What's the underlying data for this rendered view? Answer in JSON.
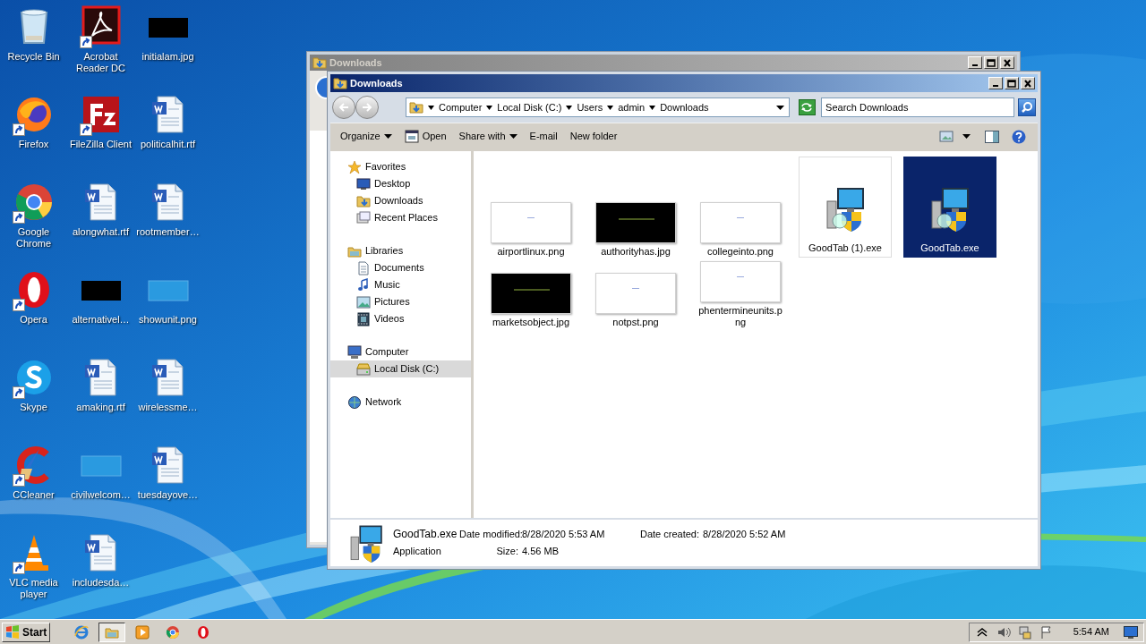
{
  "desktop_icons": [
    {
      "label": "Recycle Bin",
      "kind": "recycle",
      "shortcut": false
    },
    {
      "label": "Acrobat Reader DC",
      "kind": "acrobat",
      "shortcut": true
    },
    {
      "label": "initialam.jpg",
      "kind": "dark",
      "shortcut": false
    },
    {
      "label": "Firefox",
      "kind": "firefox",
      "shortcut": true
    },
    {
      "label": "FileZilla Client",
      "kind": "filezilla",
      "shortcut": true
    },
    {
      "label": "politicalhit.rtf",
      "kind": "document",
      "shortcut": false
    },
    {
      "label": "Google Chrome",
      "kind": "chrome",
      "shortcut": true
    },
    {
      "label": "alongwhat.rtf",
      "kind": "document",
      "shortcut": false
    },
    {
      "label": "rootmember…",
      "kind": "document",
      "shortcut": false
    },
    {
      "label": "Opera",
      "kind": "opera",
      "shortcut": true
    },
    {
      "label": "alternativel…",
      "kind": "dark",
      "shortcut": false
    },
    {
      "label": "showunit.png",
      "kind": "blank",
      "shortcut": false
    },
    {
      "label": "Skype",
      "kind": "skype",
      "shortcut": true
    },
    {
      "label": "amaking.rtf",
      "kind": "document",
      "shortcut": false
    },
    {
      "label": "wirelessme…",
      "kind": "document",
      "shortcut": false
    },
    {
      "label": "CCleaner",
      "kind": "ccleaner",
      "shortcut": true
    },
    {
      "label": "civilwelcom…",
      "kind": "blank",
      "shortcut": false
    },
    {
      "label": "tuesdayove…",
      "kind": "document",
      "shortcut": false
    },
    {
      "label": "VLC media player",
      "kind": "vlc",
      "shortcut": true
    },
    {
      "label": "includesda…",
      "kind": "document",
      "shortcut": false
    }
  ],
  "back_window": {
    "title": "Downloads"
  },
  "window": {
    "title": "Downloads",
    "breadcrumbs": [
      "Computer",
      "Local Disk (C:)",
      "Users",
      "admin",
      "Downloads"
    ],
    "search": {
      "placeholder": "Search Downloads"
    },
    "toolbar": [
      {
        "label": "Organize",
        "kind": "text",
        "menu": true
      },
      {
        "label": "Open",
        "kind": "open",
        "menu": false
      },
      {
        "label": "Share with",
        "kind": "text",
        "menu": true
      },
      {
        "label": "E-mail",
        "kind": "text",
        "menu": false
      },
      {
        "label": "New folder",
        "kind": "text",
        "menu": false
      }
    ],
    "navigation": [
      {
        "label": "Favorites",
        "kind": "star",
        "selected": false,
        "children": [
          {
            "label": "Desktop",
            "kind": "desktop",
            "selected": false
          },
          {
            "label": "Downloads",
            "kind": "download",
            "selected": false
          },
          {
            "label": "Recent Places",
            "kind": "recent",
            "selected": false
          }
        ]
      },
      {
        "label": "Libraries",
        "kind": "library",
        "selected": false,
        "children": [
          {
            "label": "Documents",
            "kind": "documents",
            "selected": false
          },
          {
            "label": "Music",
            "kind": "music",
            "selected": false
          },
          {
            "label": "Pictures",
            "kind": "pictures",
            "selected": false
          },
          {
            "label": "Videos",
            "kind": "videos",
            "selected": false
          }
        ]
      },
      {
        "label": "Computer",
        "kind": "computer",
        "selected": false,
        "children": [
          {
            "label": "Local Disk (C:)",
            "kind": "disk",
            "selected": true
          }
        ]
      },
      {
        "label": "Network",
        "kind": "network",
        "selected": false
      }
    ],
    "files": [
      {
        "name": "airportlinux.png",
        "kind": "light",
        "selected": false
      },
      {
        "name": "authorityhas.jpg",
        "kind": "dark",
        "selected": false
      },
      {
        "name": "collegeinto.png",
        "kind": "light",
        "selected": false
      },
      {
        "name": "GoodTab (1).exe",
        "kind": "program",
        "selected": false
      },
      {
        "name": "GoodTab.exe",
        "kind": "program",
        "selected": true
      },
      {
        "name": "marketsobject.jpg",
        "kind": "dark",
        "selected": false
      },
      {
        "name": "notpst.png",
        "kind": "light",
        "selected": false
      },
      {
        "name": "phentermineunits.png",
        "kind": "light",
        "selected": false
      }
    ],
    "details": {
      "name": "GoodTab.exe",
      "type": "Application",
      "fields": [
        {
          "label": "Date modified:",
          "value": "8/28/2020 5:53 AM"
        },
        {
          "label": "Date created:",
          "value": "8/28/2020 5:52 AM"
        },
        {
          "label": "Size:",
          "value": "4.56 MB"
        }
      ]
    }
  },
  "taskbar": {
    "start": "Start",
    "apps": [
      {
        "kind": "ie",
        "active": false
      },
      {
        "kind": "explorer",
        "active": true
      },
      {
        "kind": "media",
        "active": false
      },
      {
        "kind": "chrome",
        "active": false
      },
      {
        "kind": "opera",
        "active": false
      }
    ],
    "clock": "5:54 AM"
  }
}
